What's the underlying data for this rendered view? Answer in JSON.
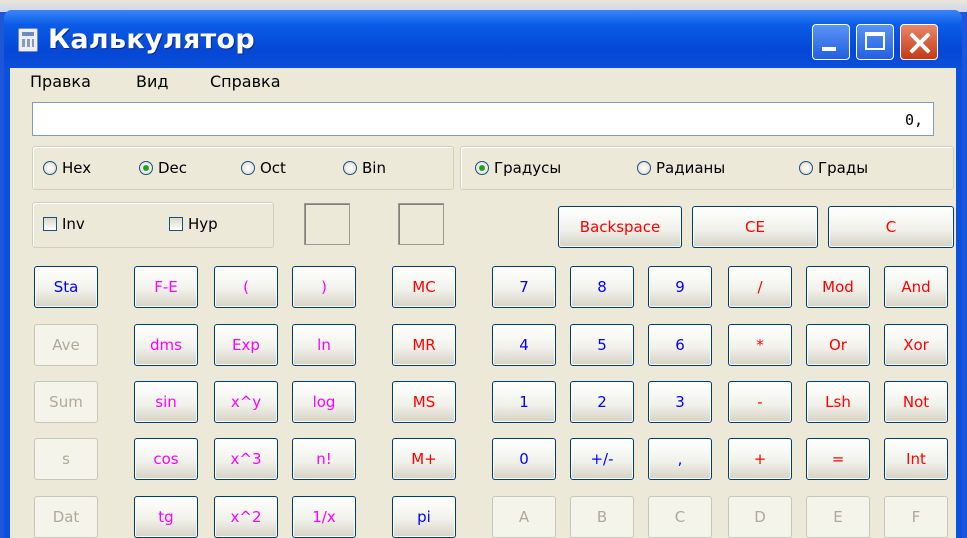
{
  "window": {
    "title": "Калькулятор"
  },
  "menu": [
    "Правка",
    "Вид",
    "Справка"
  ],
  "display": {
    "value": "0,"
  },
  "base_modes": [
    {
      "label": "Hex",
      "selected": false
    },
    {
      "label": "Dec",
      "selected": true
    },
    {
      "label": "Oct",
      "selected": false
    },
    {
      "label": "Bin",
      "selected": false
    }
  ],
  "angle_modes": [
    {
      "label": "Градусы",
      "selected": true
    },
    {
      "label": "Радианы",
      "selected": false
    },
    {
      "label": "Грады",
      "selected": false
    }
  ],
  "checkboxes": [
    {
      "label": "Inv",
      "checked": false
    },
    {
      "label": "Hyp",
      "checked": false
    }
  ],
  "edit_buttons": [
    "Backspace",
    "CE",
    "C"
  ],
  "stat_buttons": [
    "Sta",
    "Ave",
    "Sum",
    "s",
    "Dat"
  ],
  "sci_col1": [
    "F-E",
    "dms",
    "sin",
    "cos",
    "tg"
  ],
  "sci_col2": [
    "(",
    "Exp",
    "x^y",
    "x^3",
    "x^2"
  ],
  "sci_col3": [
    ")",
    "ln",
    "log",
    "n!",
    "1/x"
  ],
  "memory_buttons": [
    "MC",
    "MR",
    "MS",
    "M+",
    "pi"
  ],
  "keypad_rows": [
    [
      "7",
      "8",
      "9",
      "/",
      "Mod",
      "And"
    ],
    [
      "4",
      "5",
      "6",
      "*",
      "Or",
      "Xor"
    ],
    [
      "1",
      "2",
      "3",
      "-",
      "Lsh",
      "Not"
    ],
    [
      "0",
      "+/-",
      ",",
      "+",
      "=",
      "Int"
    ],
    [
      "A",
      "B",
      "C",
      "D",
      "E",
      "F"
    ]
  ],
  "colors": {
    "digit": "#0000ff",
    "operator": "#ff0000",
    "function": "#ff00ff",
    "disabled": "#adaa9c",
    "titlebar": "#0547d6",
    "client": "#ece9d8"
  }
}
